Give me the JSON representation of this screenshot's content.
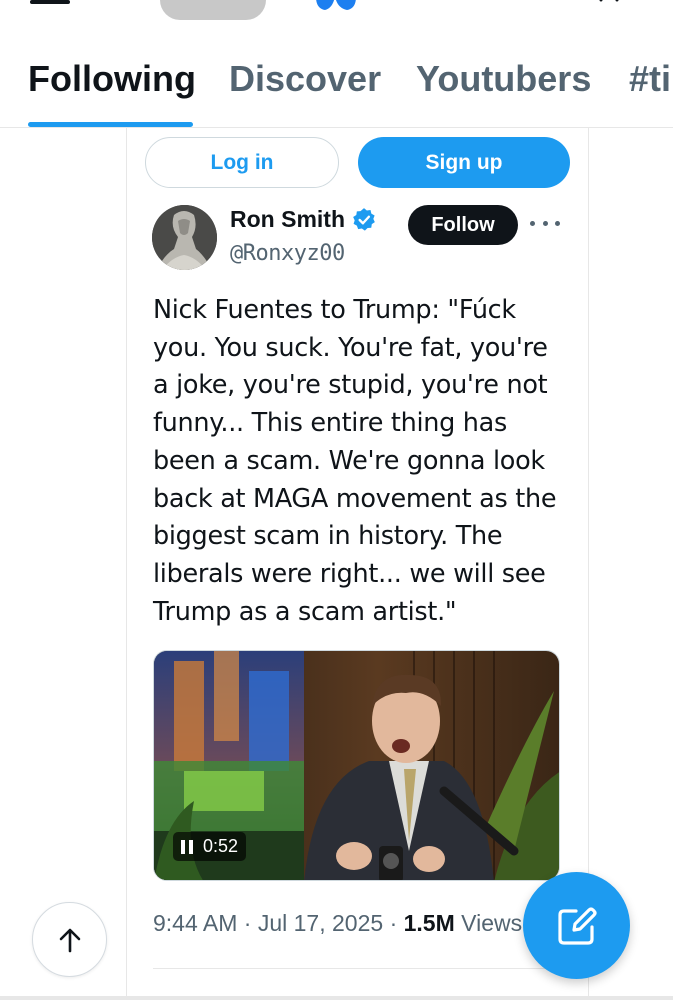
{
  "tabs": [
    {
      "label": "Following",
      "active": true
    },
    {
      "label": "Discover",
      "active": false
    },
    {
      "label": "Youtubers",
      "active": false
    },
    {
      "label": "#ti",
      "active": false
    }
  ],
  "auth": {
    "login_label": "Log in",
    "signup_label": "Sign up"
  },
  "tweet": {
    "author_name": "Ron Smith",
    "verified": true,
    "handle": "@Ronxyz00",
    "follow_label": "Follow",
    "text_lines": [
      "Nick Fuentes to Trump: \"Fúck",
      "you. You suck. You're fat, you're",
      "a joke, you're stupid, you're not",
      "funny... This entire thing has",
      "been a scam. We're gonna look",
      "back at MAGA movement as the",
      "biggest scam in history. The",
      "liberals were right... we will see",
      "Trump as a scam artist.\""
    ],
    "video_duration": "0:52",
    "video_state": "playing",
    "time": "9:44 AM",
    "date": "Jul 17, 2025",
    "views_count": "1.5M",
    "views_label": "Views"
  },
  "colors": {
    "accent": "#1d9bf0",
    "text": "#0f1419",
    "muted": "#536471",
    "border": "#e7e7e7"
  },
  "icons": {
    "scroll_top": "arrow-up-icon",
    "compose": "compose-icon",
    "more": "more-dots-icon",
    "verified": "verified-badge-icon"
  }
}
